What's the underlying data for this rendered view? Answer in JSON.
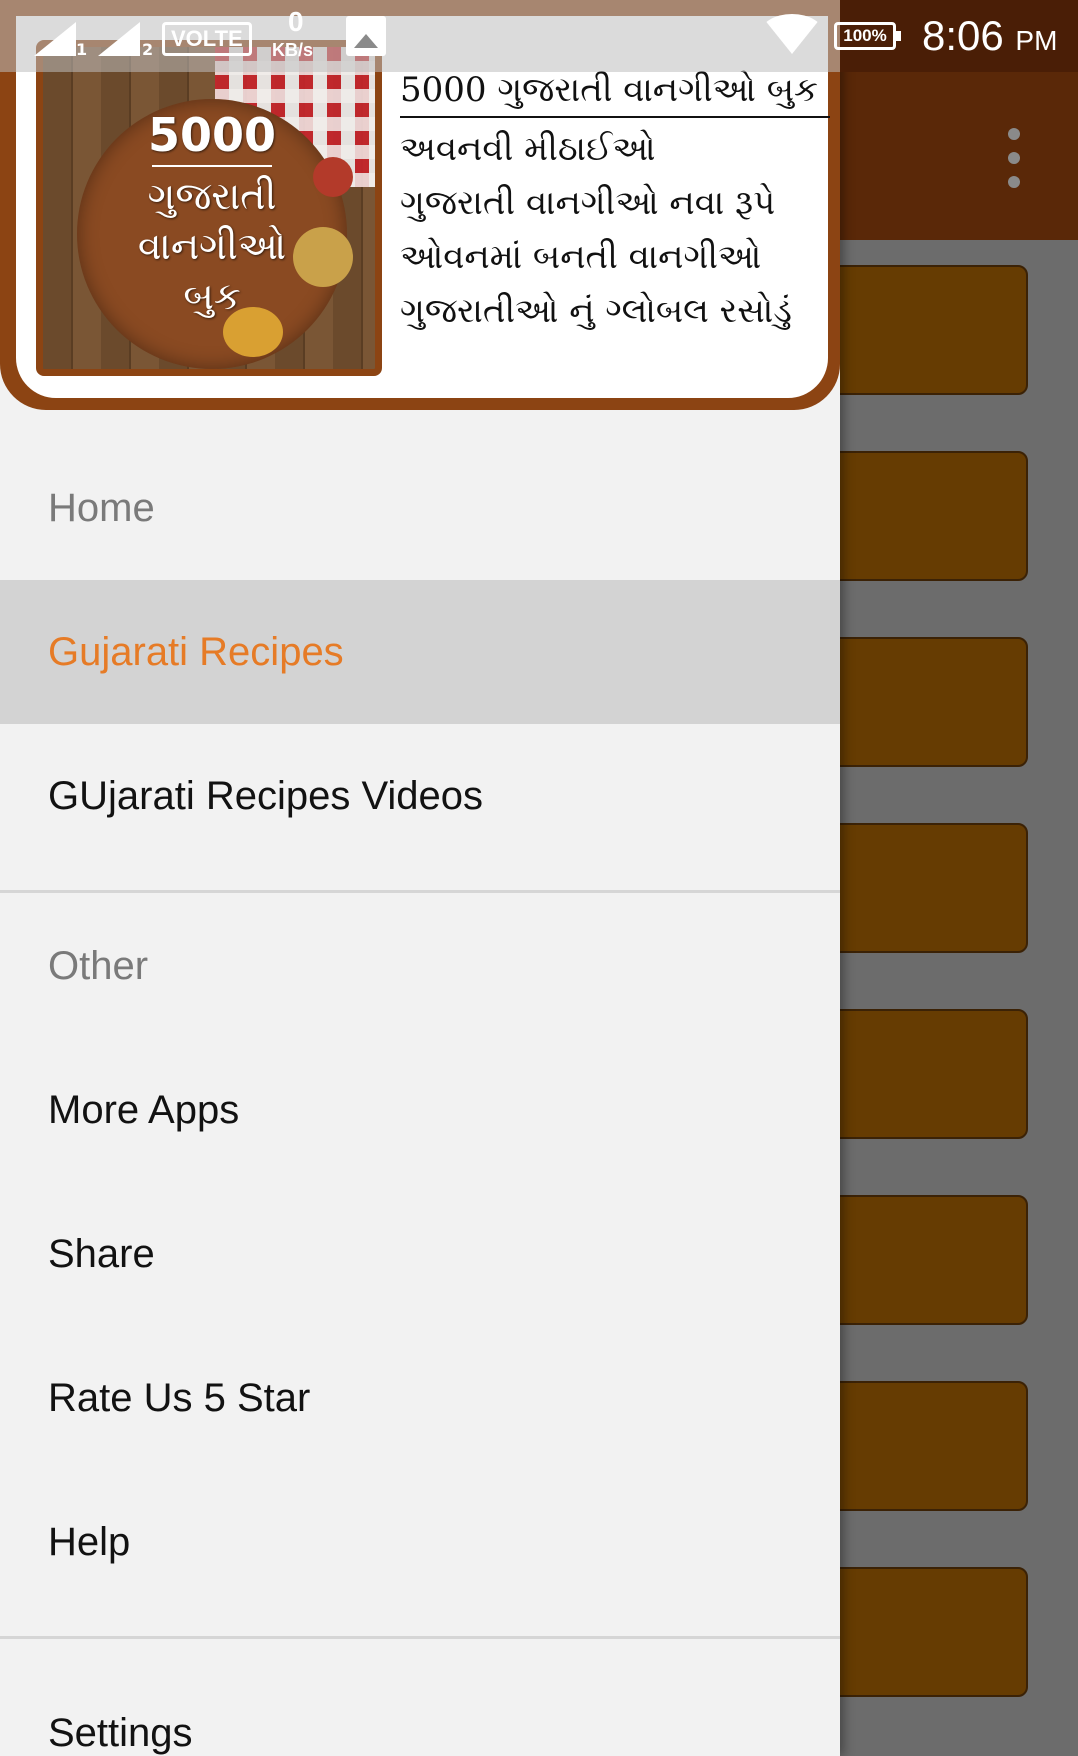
{
  "status_bar": {
    "sim1": "1",
    "sim2": "2",
    "volte": "VOLTE",
    "speed_value": "0",
    "speed_unit": "KB/s",
    "battery": "100%",
    "time": "8:06",
    "ampm": "PM"
  },
  "banner": {
    "cover": {
      "number": "5000",
      "line1": "ગુજરાતી",
      "line2": "વાનગીઓ",
      "line3": "બુક"
    },
    "title": "5000 ગુજરાતી વાનગીઓ બુક",
    "features": [
      "અવનવી મીઠાઈઓ",
      "ગુજરાતી વાનગીઓ નવા રૂપે",
      "ઓવનમાં બનતી વાનગીઓ",
      "ગુજરાતીઓ નું ગ્લોબલ રસોડું"
    ]
  },
  "menu": {
    "home": "Home",
    "gujarati_recipes": "Gujarati Recipes",
    "gujarati_recipes_videos": "GUjarati Recipes Videos",
    "other_header": "Other",
    "more_apps": "More Apps",
    "share": "Share",
    "rate_us": "Rate Us 5 Star",
    "help": "Help",
    "settings": "Settings"
  },
  "colors": {
    "accent": "#e67b26",
    "toolbar": "#5a2808",
    "banner_border": "#8c4413",
    "card": "#663c02"
  }
}
